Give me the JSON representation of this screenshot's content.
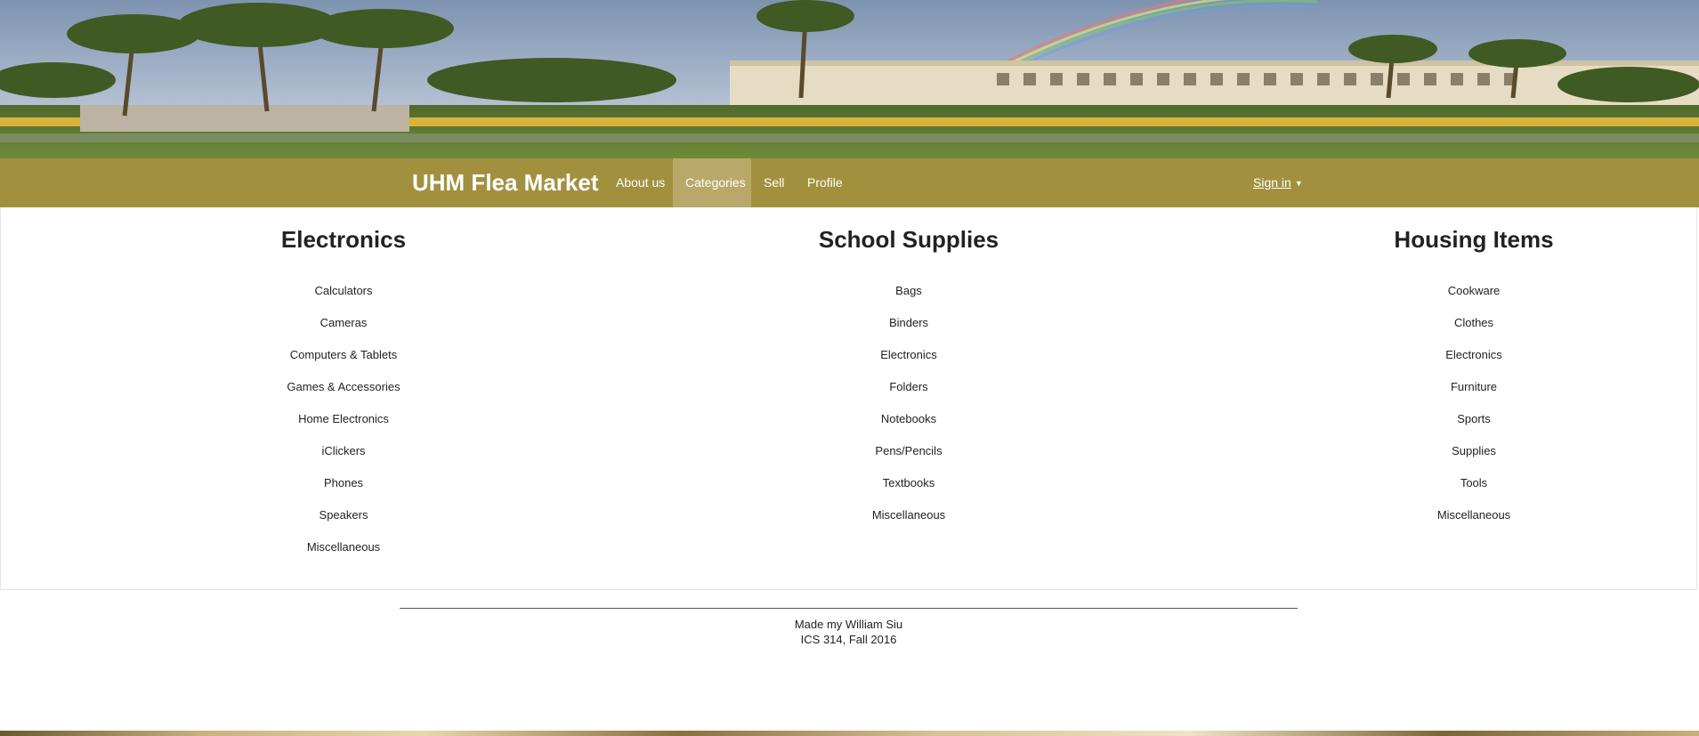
{
  "navbar": {
    "brand": "UHM Flea Market",
    "items": [
      {
        "label": "About us",
        "active": false
      },
      {
        "label": "Categories",
        "active": true
      },
      {
        "label": "Sell",
        "active": false
      },
      {
        "label": "Profile",
        "active": false
      }
    ],
    "signin_label": "Sign in",
    "signin_icon": "caret-down-icon",
    "background_color": "#a1913f",
    "active_color": "#b8a96a"
  },
  "categories": [
    {
      "title": "Electronics",
      "items": [
        "Calculators",
        "Cameras",
        "Computers & Tablets",
        "Games & Accessories",
        "Home Electronics",
        "iClickers",
        "Phones",
        "Speakers",
        "Miscellaneous"
      ]
    },
    {
      "title": "School Supplies",
      "items": [
        "Bags",
        "Binders",
        "Electronics",
        "Folders",
        "Notebooks",
        "Pens/Pencils",
        "Textbooks",
        "Miscellaneous"
      ]
    },
    {
      "title": "Housing Items",
      "items": [
        "Cookware",
        "Clothes",
        "Electronics",
        "Furniture",
        "Sports",
        "Supplies",
        "Tools",
        "Miscellaneous"
      ]
    }
  ],
  "footer": {
    "line1": "Made my William Siu",
    "line2": "ICS 314, Fall 2016"
  }
}
